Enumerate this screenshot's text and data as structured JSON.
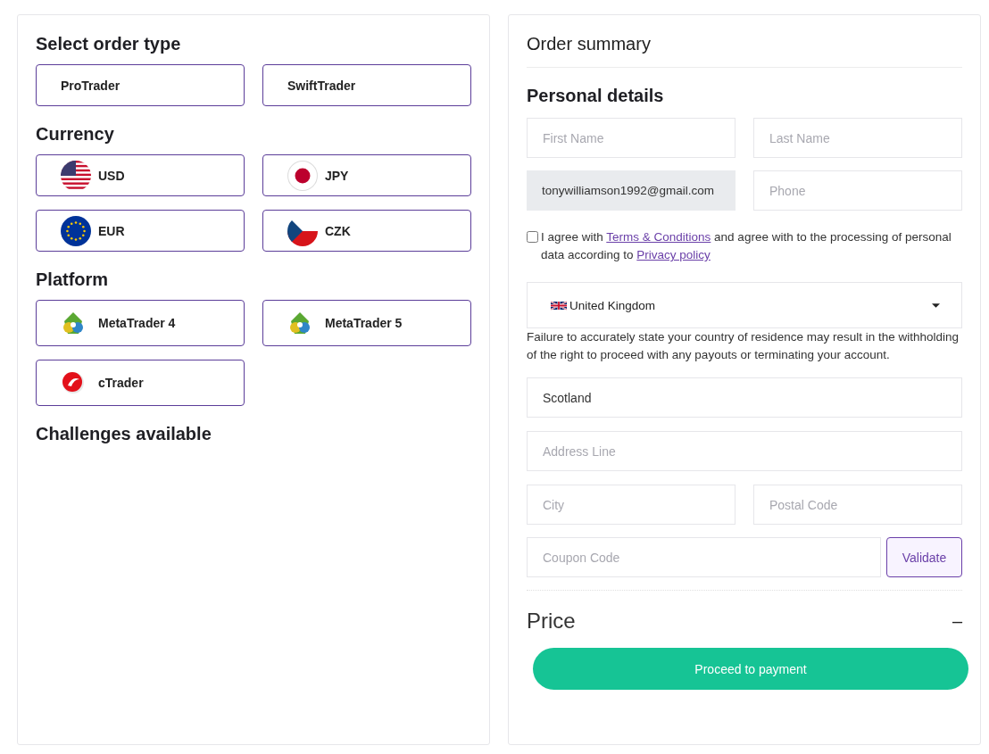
{
  "order_type": {
    "title": "Select order type",
    "options": [
      {
        "label": "ProTrader",
        "selected": false
      },
      {
        "label": "SwiftTrader",
        "selected": false
      }
    ]
  },
  "currency": {
    "title": "Currency",
    "options": [
      {
        "label": "USD",
        "selected": false
      },
      {
        "label": "JPY",
        "selected": false
      },
      {
        "label": "EUR",
        "selected": false
      },
      {
        "label": "CZK",
        "selected": false
      }
    ]
  },
  "platform": {
    "title": "Platform",
    "options": [
      {
        "label": "MetaTrader 4",
        "selected": false
      },
      {
        "label": "MetaTrader 5",
        "selected": false
      },
      {
        "label": "cTrader",
        "selected": false
      }
    ]
  },
  "challenges": {
    "title": "Challenges available"
  },
  "summary": {
    "title": "Order summary",
    "personal_title": "Personal details",
    "first_name": {
      "placeholder": "First Name"
    },
    "last_name": {
      "placeholder": "Last Name"
    },
    "email": {
      "value": "tonywilliamson1992@gmail.com",
      "disabled": true
    },
    "phone": {
      "placeholder": "Phone"
    },
    "consent": {
      "checked": false,
      "before": "I agree with",
      "terms_link": "Terms & Conditions",
      "middle": "and agree with to the processing of personal data according to",
      "privacy_link": "Privacy policy"
    },
    "country": {
      "value": "United Kingdom"
    },
    "country_note": "Failure to accurately state your country of residence may result in the withholding of the right to proceed with any payouts or terminating your account.",
    "region": {
      "value": "Scotland"
    },
    "address": {
      "placeholder": "Address Line"
    },
    "city": {
      "placeholder": "City"
    },
    "postal_code": {
      "placeholder": "Postal Code"
    },
    "coupon": {
      "placeholder": "Coupon Code"
    },
    "validate_button": "Validate",
    "price_title": "Price",
    "price_value": "–",
    "proceed_button": "Proceed to payment"
  }
}
